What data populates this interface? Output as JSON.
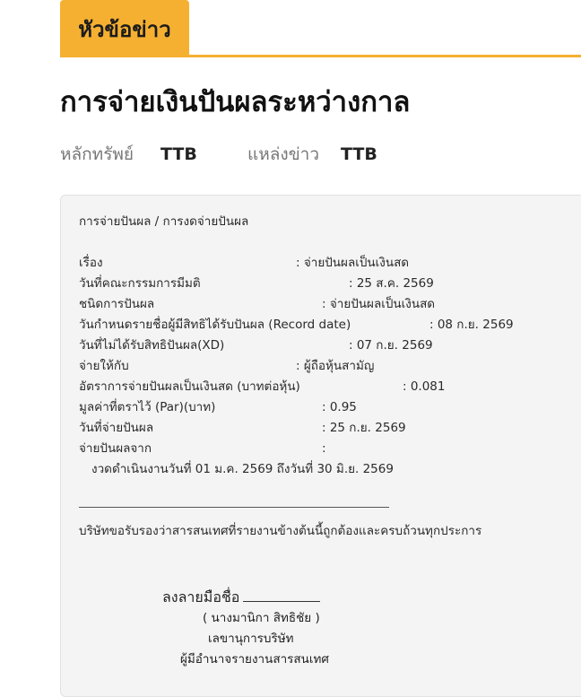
{
  "header": {
    "tab_label": "หัวข้อข่าว"
  },
  "page": {
    "title": "การจ่ายเงินปันผลระหว่างกาล"
  },
  "meta": {
    "security_label": "หลักทรัพย์",
    "security_value": "TTB",
    "source_label": "แหล่งข่าว",
    "source_value": "TTB"
  },
  "document": {
    "heading": "การจ่ายปันผล / การงดจ่ายปันผล",
    "rows": [
      {
        "key": "เรื่อง",
        "value": ": จ่ายปันผลเป็นเงินสด"
      },
      {
        "key": "วันที่คณะกรรมการมีมติ",
        "value": ": 25 ส.ค. 2569"
      },
      {
        "key": "ชนิดการปันผล",
        "value": ": จ่ายปันผลเป็นเงินสด"
      },
      {
        "key": "วันกำหนดรายชื่อผู้มีสิทธิได้รับปันผล (Record date)",
        "value": ": 08 ก.ย. 2569"
      },
      {
        "key": "วันที่ไม่ได้รับสิทธิปันผล(XD)",
        "value": ": 07 ก.ย. 2569"
      },
      {
        "key": "จ่ายให้กับ",
        "value": ": ผู้ถือหุ้นสามัญ"
      },
      {
        "key": "อัตราการจ่ายปันผลเป็นเงินสด (บาทต่อหุ้น)",
        "value": ": 0.081"
      },
      {
        "key": "มูลค่าที่ตราไว้ (Par)(บาท)",
        "value": ": 0.95"
      },
      {
        "key": "วันที่จ่ายปันผล",
        "value": ": 25 ก.ย. 2569"
      },
      {
        "key": "จ่ายปันผลจาก",
        "value": ":"
      }
    ],
    "period_line": "งวดดำเนินงานวันที่ 01 ม.ค. 2569 ถึงวันที่ 30 มิ.ย. 2569",
    "certify": "บริษัทขอรับรองว่าสารสนเทศที่รายงานข้างต้นนี้ถูกต้องและครบถ้วนทุกประการ",
    "signature": {
      "label": "ลงลายมือชื่อ",
      "name": "( นางมานิกา สิทธิชัย )",
      "position": "เลขานุการบริษัท",
      "authority": "ผู้มีอำนาจรายงานสารสนเทศ"
    }
  }
}
